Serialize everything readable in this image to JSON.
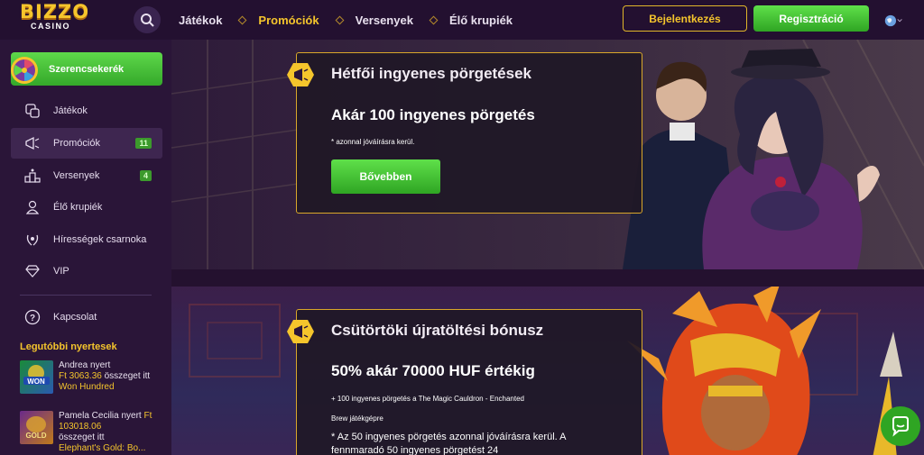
{
  "brand": {
    "logo_main": "BIZZO",
    "logo_sub": "CASINO"
  },
  "header": {
    "nav": [
      {
        "label": "Játékok",
        "active": false
      },
      {
        "label": "Promóciók",
        "active": true
      },
      {
        "label": "Versenyek",
        "active": false
      },
      {
        "label": "Élő krupiék",
        "active": false
      }
    ],
    "login_label": "Bejelentkezés",
    "register_label": "Regisztráció"
  },
  "sidebar": {
    "wheel_label": "Szerencsekerék",
    "items": [
      {
        "label": "Játékok",
        "icon": "games-icon",
        "badge": ""
      },
      {
        "label": "Promóciók",
        "icon": "megaphone-icon",
        "badge": "11"
      },
      {
        "label": "Versenyek",
        "icon": "tournament-icon",
        "badge": "4"
      },
      {
        "label": "Élő krupiék",
        "icon": "dealer-icon",
        "badge": ""
      },
      {
        "label": "Hírességek csarnoka",
        "icon": "laurel-icon",
        "badge": ""
      },
      {
        "label": "VIP",
        "icon": "diamond-icon",
        "badge": ""
      },
      {
        "label": "Kapcsolat",
        "icon": "help-icon",
        "badge": ""
      }
    ],
    "winners_title": "Legutóbbi nyertesek",
    "winners": [
      {
        "name_line": "Andrea nyert",
        "amount": "Ft 3063.36",
        "suffix": "összeget itt",
        "game": "Won Hundred",
        "thumb_label": "WON"
      },
      {
        "name_line": "Pamela Cecilia nyert",
        "amount": "Ft 103018.06",
        "suffix": "összeget itt",
        "game": "Elephant's Gold: Bo...",
        "thumb_label": "GOLD"
      }
    ]
  },
  "promos": [
    {
      "title": "Hétfői ingyenes pörgetések",
      "headline": "Akár 100 ingyenes pörgetés",
      "note": "* azonnal jóváírásra kerül.",
      "button": "Bővebben"
    },
    {
      "title": "Csütörtöki újratöltési bónusz",
      "headline": "50% akár 70000 HUF értékig",
      "body_1": "+ 100 ingyenes pörgetés a The Magic Cauldron - Enchanted",
      "body_2": "Brew játékgépre",
      "body_3": "* Az 50 ingyenes pörgetés azonnal jóváírásra kerül. A fennmaradó 50 ingyenes pörgetést 24"
    }
  ],
  "colors": {
    "accent_gold": "#f5c52c",
    "accent_green": "#3fbf2f",
    "bg": "#2a1538"
  }
}
